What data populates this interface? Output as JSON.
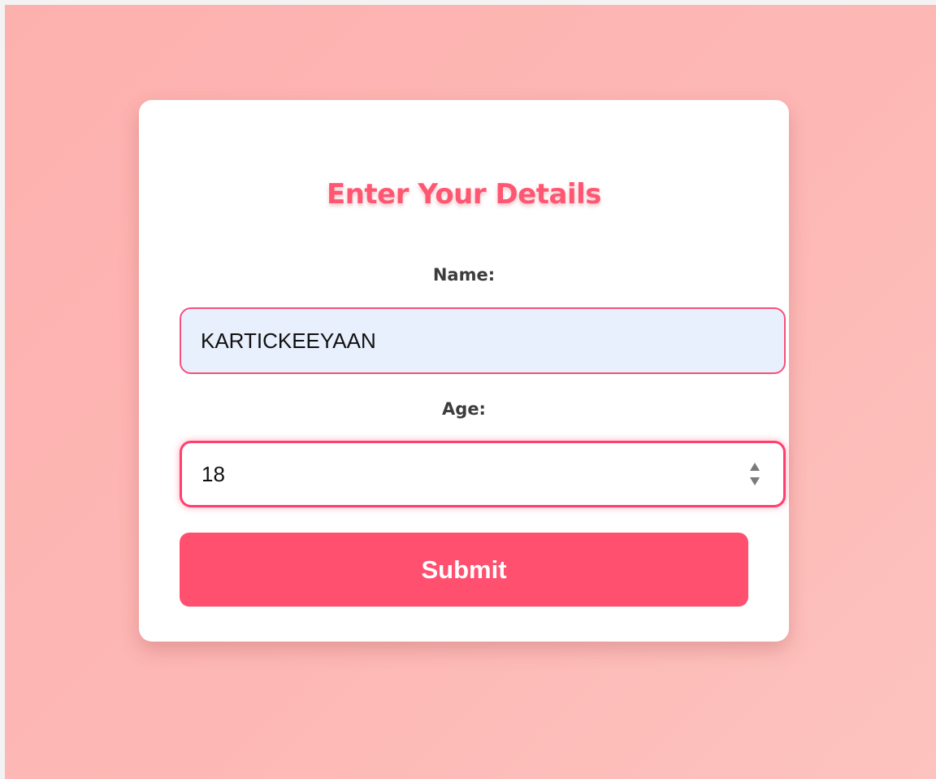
{
  "form": {
    "title": "Enter Your Details",
    "name_label": "Name:",
    "name_value": "KARTICKEEYAAN",
    "age_label": "Age:",
    "age_value": "18",
    "submit_label": "Submit"
  },
  "icons": {
    "spinner": "number-spinner-icon"
  },
  "colors": {
    "accent": "#ff516f",
    "title": "#ff5771",
    "background": "#fdb8b5",
    "name_field_background": "#e8effd",
    "field_border": "#f5517a"
  }
}
